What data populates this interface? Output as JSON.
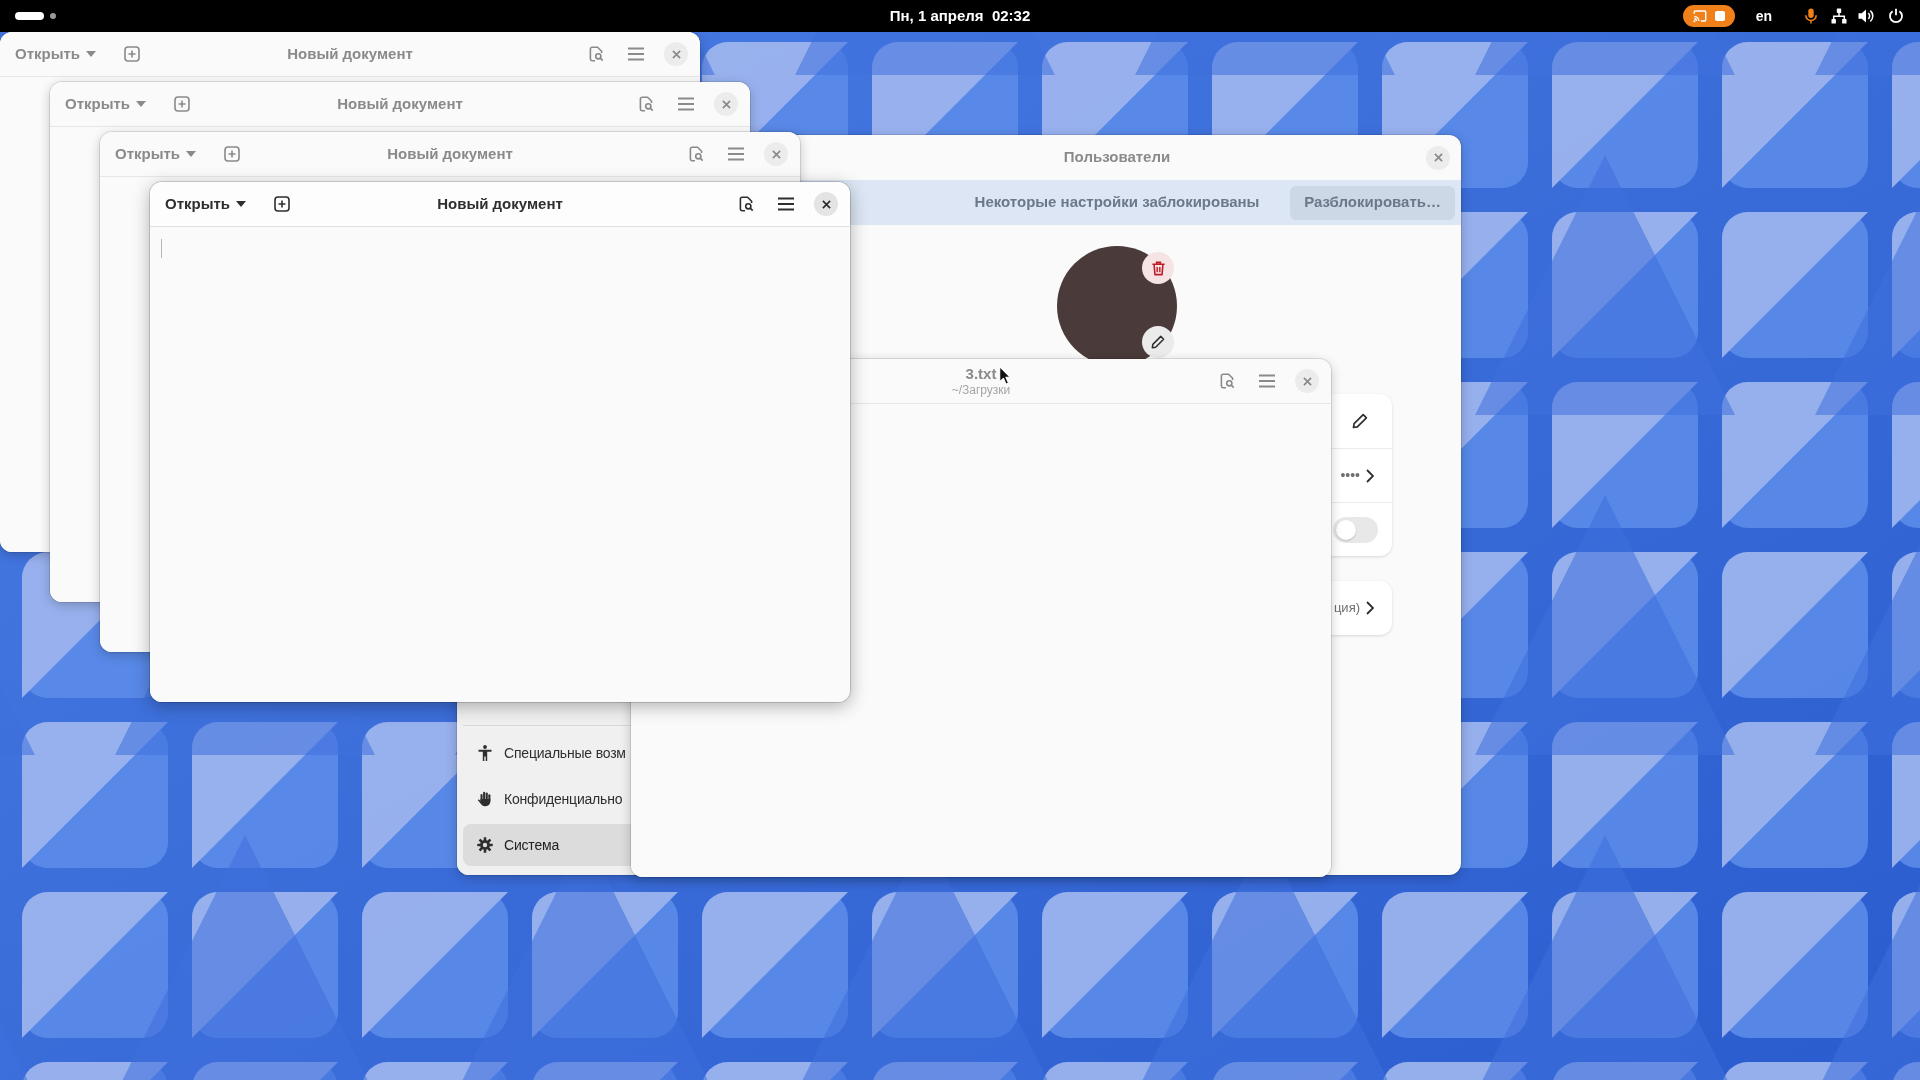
{
  "top_bar": {
    "workspaces": [
      {
        "selected": true
      },
      {
        "selected": false
      }
    ],
    "clock": "Пн, 1 апреля  02:32",
    "status_area": [
      {
        "kind": "screencast"
      },
      {
        "kind": "keyboard",
        "label": "en"
      },
      {
        "kind": "microphone"
      },
      {
        "kind": "network"
      },
      {
        "kind": "volume"
      },
      {
        "kind": "power"
      }
    ]
  },
  "editor_windows": [
    {
      "open_button": "Открыть",
      "title": "Новый документ",
      "focused": false
    },
    {
      "open_button": "Открыть",
      "title": "Новый документ",
      "focused": false
    },
    {
      "open_button": "Открыть",
      "title": "Новый документ",
      "focused": false
    },
    {
      "open_button": "Открыть",
      "title": "Новый документ",
      "focused": true
    }
  ],
  "settings_window": {
    "title": "Пользователи",
    "focused": false,
    "banner": {
      "text": "Некоторые настройки заблокированы",
      "button": "Разблокировать…"
    },
    "sidebar": {
      "items": [
        {
          "label": "Специальные возм",
          "selected": false
        },
        {
          "label": "Конфиденциально",
          "selected": false
        },
        {
          "label": "Система",
          "selected": true
        }
      ]
    },
    "account_rows": [
      {
        "kind": "edit"
      },
      {
        "kind": "password",
        "value": "••••"
      },
      {
        "kind": "switch",
        "on": false
      }
    ],
    "language_row": {
      "value": "ция)"
    }
  },
  "file_window": {
    "title": "3.txt",
    "subtitle": "~/Загрузки",
    "focused": false
  }
}
